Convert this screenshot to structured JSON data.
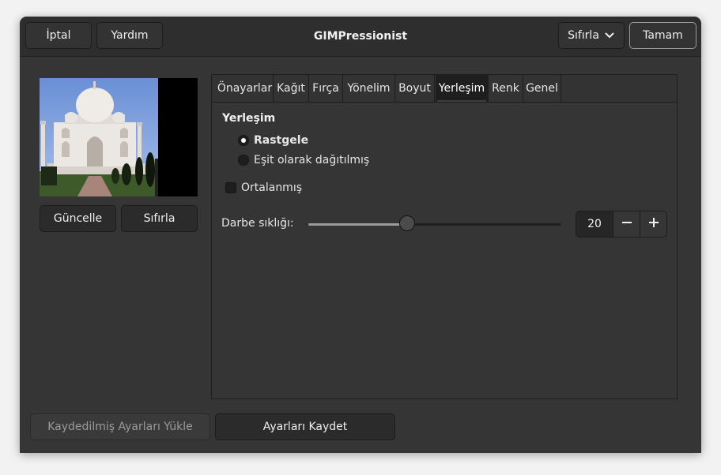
{
  "header": {
    "title": "GIMPressionist",
    "cancel_label": "İptal",
    "help_label": "Yardım",
    "reset_label": "Sıfırla",
    "ok_label": "Tamam"
  },
  "preview": {
    "update_label": "Güncelle",
    "reset_label": "Sıfırla"
  },
  "tabs": [
    {
      "label": "Önayarlar"
    },
    {
      "label": "Kağıt"
    },
    {
      "label": "Fırça"
    },
    {
      "label": "Yönelim"
    },
    {
      "label": "Boyut"
    },
    {
      "label": "Yerleşim",
      "active": true
    },
    {
      "label": "Renk"
    },
    {
      "label": "Genel"
    }
  ],
  "placement": {
    "section_title": "Yerleşim",
    "options": [
      {
        "label": "Rastgele",
        "selected": true
      },
      {
        "label": "Eşit olarak dağıtılmış",
        "selected": false
      }
    ],
    "centered_label": "Ortalanmış",
    "centered_checked": false,
    "stroke_density_label": "Darbe sıklığı:",
    "stroke_density_value": "20",
    "stroke_density_fraction": 0.39
  },
  "footer": {
    "load_label": "Kaydedilmiş Ayarları Yükle",
    "save_label": "Ayarları Kaydet"
  },
  "icons": {
    "chevron": "chevron-down-icon",
    "minus": "minus-icon",
    "plus": "plus-icon"
  }
}
